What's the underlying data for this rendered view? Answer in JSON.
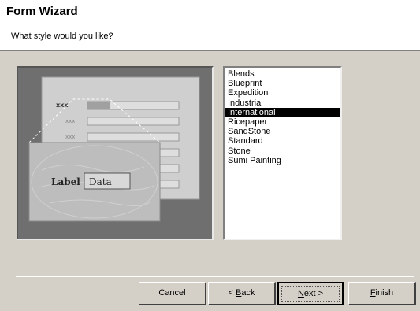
{
  "window": {
    "title": "Form Wizard",
    "prompt": "What style would you like?"
  },
  "preview": {
    "field_labels": [
      "xxx",
      "xxx",
      "xxx"
    ],
    "label_text": "Label",
    "data_text": "Data"
  },
  "styles": {
    "items": [
      "Blends",
      "Blueprint",
      "Expedition",
      "Industrial",
      "International",
      "Ricepaper",
      "SandStone",
      "Standard",
      "Stone",
      "Sumi Painting"
    ],
    "selected": "International"
  },
  "buttons": {
    "cancel": "Cancel",
    "back_prefix": "< ",
    "back_hotkey": "B",
    "back_rest": "ack",
    "next_hotkey": "N",
    "next_rest": "ext >",
    "finish_hotkey": "F",
    "finish_rest": "inish"
  },
  "colors": {
    "dialog_bg": "#d4d0c8",
    "header_bg": "#ffffff",
    "preview_bg": "#6f6f6f",
    "selection_bg": "#000000"
  }
}
